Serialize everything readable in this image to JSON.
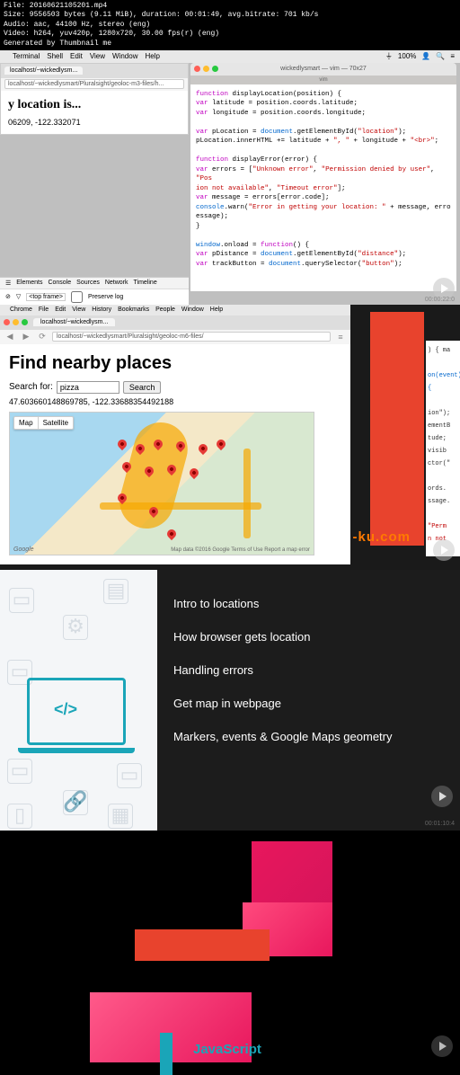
{
  "meta": {
    "file": "File: 20160621105201.mp4",
    "size": "Size: 9556503 bytes (9.11 MiB), duration: 00:01:49, avg.bitrate: 701 kb/s",
    "audio": "Audio: aac, 44100 Hz, stereo (eng)",
    "video": "Video: h264, yuv420p, 1280x720, 30.00 fps(r) (eng)",
    "gen": "Generated by Thumbnail me"
  },
  "mac": {
    "menu": [
      "Terminal",
      "Shell",
      "Edit",
      "View",
      "Window",
      "Help"
    ],
    "clock": "100%"
  },
  "left_win": {
    "tab": "localhost/~wickedlysm...",
    "url": "localhost/~wickedlysmart/Pluralsight/geoloc-m3-files/h...",
    "heading": "y location is...",
    "coords": "06209, -122.332071"
  },
  "devtools": {
    "tabs": [
      "Elements",
      "Console",
      "Sources",
      "Network",
      "Timeline"
    ],
    "frame": "<top frame>",
    "preserve": "Preserve log"
  },
  "term": {
    "title": "wickedlysmart — vim — 70x27",
    "sub": "vim",
    "l1a": "function",
    "l1b": " displayLocation(position) {",
    "l2a": "var",
    "l2b": " latitude = position.coords.latitude;",
    "l3a": "var",
    "l3b": " longitude = position.coords.longitude;",
    "l4a": "var",
    "l4b": " pLocation = ",
    "l4c": "document",
    "l4d": ".getElementById(",
    "l4e": "\"location\"",
    "l4f": ");",
    "l5": "    pLocation.innerHTML += latitude + ",
    "l5s": "\", \"",
    "l5t": " + longitude + ",
    "l5u": "\"<br>\"",
    "l5v": ";",
    "l6a": "function",
    "l6b": " displayError(error) {",
    "l7a": "var",
    "l7b": " errors = [",
    "l7c": "\"Unknown error\"",
    "l7d": ", ",
    "l7e": "\"Permission denied by user\"",
    "l7f": ", ",
    "l7g": "\"Pos",
    "l8": "ion not available\"",
    "l8b": ", ",
    "l8c": "\"Timeout error\"",
    "l8d": "];",
    "l9a": "var",
    "l9b": " message = errors[error.code];",
    "l10a": "console",
    "l10b": ".warn(",
    "l10c": "\"Error in getting your location: \"",
    "l10d": " + message, erro",
    "l11": "essage);",
    "l12": "}",
    "l13a": "window",
    "l13b": ".onload = ",
    "l13c": "function",
    "l13d": "() {",
    "l14a": "var",
    "l14b": " pDistance = ",
    "l14c": "document",
    "l14d": ".getElementById(",
    "l14e": "\"distance\"",
    "l14f": ");",
    "l15a": "var",
    "l15b": " trackButton = ",
    "l15c": "document",
    "l15d": ".querySelector(",
    "l15e": "\"button\"",
    "l15f": ");",
    "time": "00:00:22:0"
  },
  "chrome": {
    "menu": [
      "Chrome",
      "File",
      "Edit",
      "View",
      "History",
      "Bookmarks",
      "People",
      "Window",
      "Help"
    ],
    "tab": "localhost/~wickedlysm...",
    "url": "localhost/~wickedlysmart/Pluralsight/geoloc-m6-files/"
  },
  "places": {
    "h1": "Find nearby places",
    "search_label": "Search for:",
    "search_value": "pizza",
    "search_btn": "Search",
    "coords": "47.603660148869785, -122.33688354492188",
    "map_btn": "Map",
    "sat_btn": "Satellite",
    "google": "Google",
    "attr": "Map data ©2016 Google   Terms of Use   Report a map error"
  },
  "snippets": {
    "a": ") { ma",
    "b": "on(event) {",
    "c": "ion\");",
    "d": "ementB",
    "e": "visib",
    "f": "ctor(\"",
    "g": "tude;",
    "h": "ords.",
    "i": "ssage.",
    "j": "\"Perm",
    "k": "n not"
  },
  "watermark": "-ku.com",
  "toc": {
    "i1": "Intro to locations",
    "i2": "How browser gets location",
    "i3": "Handling errors",
    "i4": "Get map in webpage",
    "i5": "Markers, events & Google Maps geometry",
    "time": "00:01:10:4"
  },
  "p4": {
    "label": "JavaScript"
  }
}
